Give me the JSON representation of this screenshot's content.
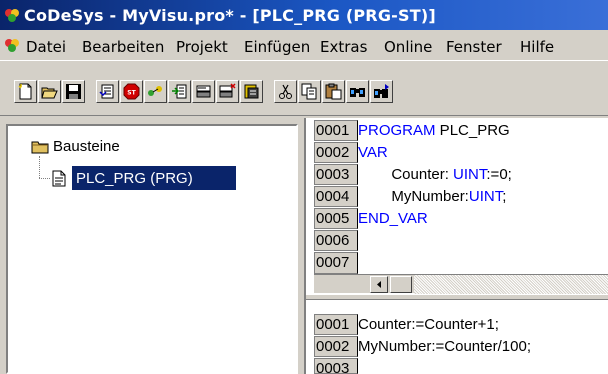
{
  "window": {
    "title": "CoDeSys - MyVisu.pro* - [PLC_PRG (PRG-ST)]"
  },
  "menu": {
    "items": [
      "Datei",
      "Bearbeiten",
      "Projekt",
      "Einfügen",
      "Extras",
      "Online",
      "Fenster",
      "Hilfe"
    ]
  },
  "toolbar": {
    "buttons": [
      {
        "icon": "new-file-icon"
      },
      {
        "icon": "open-folder-icon"
      },
      {
        "icon": "save-icon"
      },
      {
        "icon": "build-icon"
      },
      {
        "icon": "stop-icon",
        "label": "ST"
      },
      {
        "icon": "login-icon"
      },
      {
        "icon": "logout-icon"
      },
      {
        "icon": "run-icon"
      },
      {
        "icon": "reset-icon"
      },
      {
        "icon": "step-icon"
      },
      {
        "icon": "cut-icon"
      },
      {
        "icon": "copy-icon"
      },
      {
        "icon": "paste-icon"
      },
      {
        "icon": "find-icon"
      },
      {
        "icon": "find-next-icon"
      }
    ]
  },
  "tree": {
    "root_label": "Bausteine",
    "child_label": "PLC_PRG (PRG)"
  },
  "declaration": {
    "lines": [
      {
        "num": "0001",
        "keyword": "PROGRAM",
        "rest": " PLC_PRG"
      },
      {
        "num": "0002",
        "keyword": "VAR",
        "rest": ""
      },
      {
        "num": "0003",
        "pre": "        Counter: ",
        "type": "UINT",
        "post": ":=0;"
      },
      {
        "num": "0004",
        "pre": "        MyNumber:",
        "type": "UINT",
        "post": ";"
      },
      {
        "num": "0005",
        "keyword": "END_VAR",
        "rest": ""
      },
      {
        "num": "0006",
        "keyword": "",
        "rest": ""
      },
      {
        "num": "0007",
        "keyword": "",
        "rest": ""
      }
    ]
  },
  "body": {
    "lines": [
      {
        "num": "0001",
        "text": "Counter:=Counter+1;"
      },
      {
        "num": "0002",
        "text": "MyNumber:=Counter/100;"
      },
      {
        "num": "0003",
        "text": ""
      }
    ]
  },
  "colors": {
    "keyword": "#0000ff",
    "selection": "#0a246a",
    "title_bar": "#0a246a"
  }
}
